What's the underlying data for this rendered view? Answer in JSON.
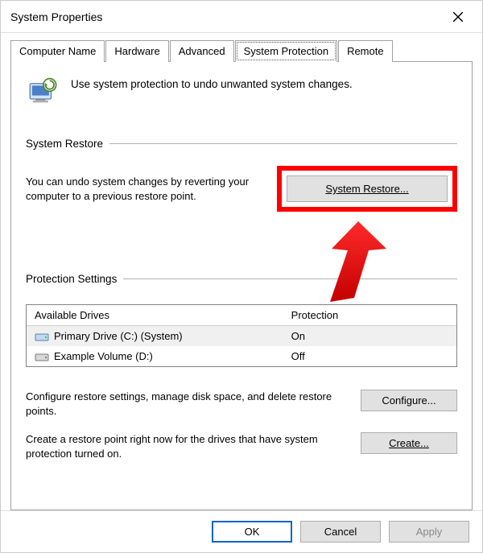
{
  "window": {
    "title": "System Properties"
  },
  "tabs": [
    {
      "label": "Computer Name"
    },
    {
      "label": "Hardware"
    },
    {
      "label": "Advanced"
    },
    {
      "label": "System Protection"
    },
    {
      "label": "Remote"
    }
  ],
  "intro": {
    "text": "Use system protection to undo unwanted system changes."
  },
  "restore": {
    "heading": "System Restore",
    "desc": "You can undo system changes by reverting your computer to a previous restore point.",
    "button": "System Restore..."
  },
  "protection": {
    "heading": "Protection Settings",
    "columns": {
      "drive": "Available Drives",
      "status": "Protection"
    },
    "rows": [
      {
        "name": "Primary Drive (C:) (System)",
        "status": "On"
      },
      {
        "name": "Example Volume (D:)",
        "status": "Off"
      }
    ],
    "configure": {
      "desc": "Configure restore settings, manage disk space, and delete restore points.",
      "button": "Configure..."
    },
    "create": {
      "desc": "Create a restore point right now for the drives that have system protection turned on.",
      "button": "Create..."
    }
  },
  "footer": {
    "ok": "OK",
    "cancel": "Cancel",
    "apply": "Apply"
  }
}
